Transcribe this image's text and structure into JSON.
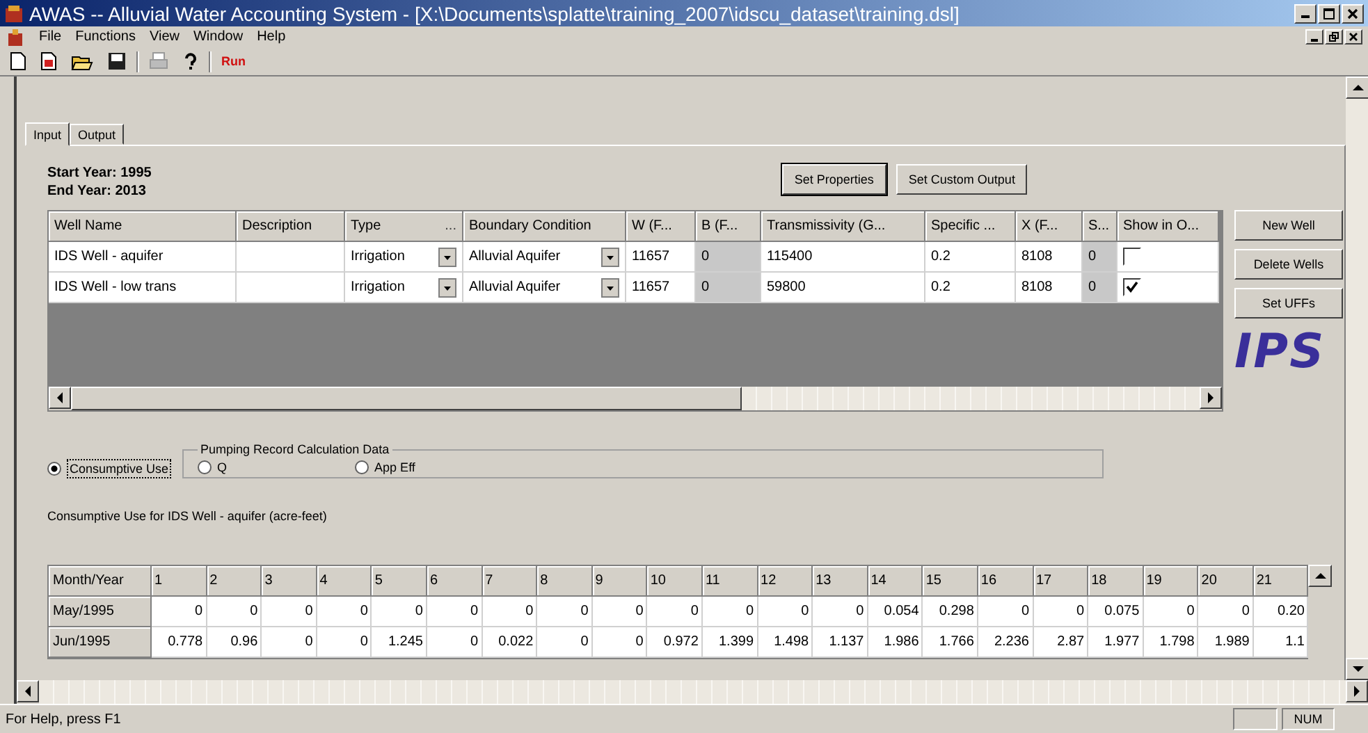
{
  "window": {
    "title": "AWAS -- Alluvial Water Accounting System - [X:\\Documents\\splatte\\training_2007\\idscu_dataset\\training.dsl]"
  },
  "menu": [
    "File",
    "Functions",
    "View",
    "Window",
    "Help"
  ],
  "toolbar": {
    "run_label": "Run"
  },
  "tabs": [
    {
      "label": "Input",
      "selected": true
    },
    {
      "label": "Output",
      "selected": false
    }
  ],
  "start_year": "Start Year: 1995",
  "end_year": "End Year: 2013",
  "top_buttons": [
    "Set Properties",
    "Set Custom Output"
  ],
  "wells_table": {
    "columns": [
      {
        "label": "Well Name",
        "kind": "text",
        "shaded": false
      },
      {
        "label": "Description",
        "kind": "text",
        "shaded": false
      },
      {
        "label": "Type",
        "ellipsis": "...",
        "kind": "combo",
        "shaded": false
      },
      {
        "label": "Boundary Condition",
        "kind": "combo",
        "shaded": false
      },
      {
        "label": "W (F...",
        "kind": "text",
        "shaded": false
      },
      {
        "label": "B (F...",
        "kind": "text",
        "shaded": true
      },
      {
        "label": "Transmissivity (G...",
        "kind": "text",
        "shaded": false
      },
      {
        "label": "Specific ...",
        "kind": "text",
        "shaded": false
      },
      {
        "label": "X (F...",
        "kind": "text",
        "shaded": false
      },
      {
        "label": "S...",
        "kind": "text",
        "shaded": true
      },
      {
        "label": "Show in O...",
        "kind": "check",
        "shaded": false
      }
    ],
    "rows": [
      {
        "cells": [
          "IDS Well - aquifer",
          null,
          "Irrigation",
          "Alluvial Aquifer",
          "11657",
          "0",
          "115400",
          "0.2",
          "8108",
          "0",
          null
        ],
        "show_in_output": false
      },
      {
        "cells": [
          "IDS Well - low trans",
          null,
          "Irrigation",
          "Alluvial Aquifer",
          "11657",
          "0",
          "59800",
          "0.2",
          "8108",
          "0",
          null
        ],
        "show_in_output": true
      }
    ]
  },
  "side_buttons": [
    "New Well",
    "Delete Wells",
    "Set UFFs"
  ],
  "logo": "IPS",
  "mode_radio": {
    "label": "Consumptive Use",
    "selected": true
  },
  "pumping_group": {
    "title": "Pumping Record Calculation Data",
    "options": [
      {
        "label": "Q",
        "selected": false
      },
      {
        "label": "App Eff",
        "selected": false
      }
    ]
  },
  "cu_caption": "Consumptive Use for IDS Well - aquifer (acre-feet)",
  "cu_table": {
    "corner": "Month/Year",
    "columns": [
      "1",
      "2",
      "3",
      "4",
      "5",
      "6",
      "7",
      "8",
      "9",
      "10",
      "11",
      "12",
      "13",
      "14",
      "15",
      "16",
      "17",
      "18",
      "19",
      "20",
      "21"
    ],
    "rows": [
      {
        "label": "May/1995",
        "values": [
          "0",
          "0",
          "0",
          "0",
          "0",
          "0",
          "0",
          "0",
          "0",
          "0",
          "0",
          "0",
          "0",
          "0.054",
          "0.298",
          "0",
          "0",
          "0.075",
          "0",
          "0",
          "0.20"
        ]
      },
      {
        "label": "Jun/1995",
        "values": [
          "0.778",
          "0.96",
          "0",
          "0",
          "1.245",
          "0",
          "0.022",
          "0",
          "0",
          "0.972",
          "1.399",
          "1.498",
          "1.137",
          "1.986",
          "1.766",
          "2.236",
          "2.87",
          "1.977",
          "1.798",
          "1.989",
          "1.1"
        ]
      }
    ]
  },
  "status_bar": {
    "message": "For Help, press F1",
    "num": "NUM"
  }
}
